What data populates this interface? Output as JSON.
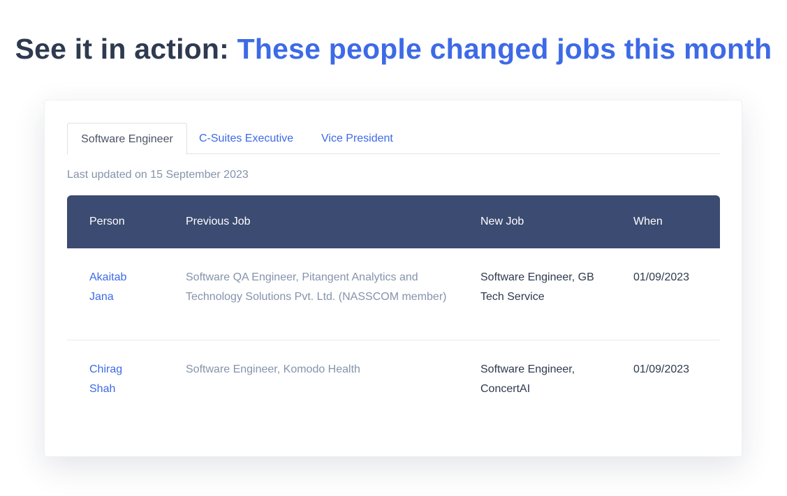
{
  "headline": {
    "lead": "See it in action: ",
    "accent": "These people changed jobs this month"
  },
  "tabs": [
    {
      "label": "Software Engineer",
      "active": true
    },
    {
      "label": "C-Suites Executive",
      "active": false
    },
    {
      "label": "Vice President",
      "active": false
    }
  ],
  "last_updated": "Last updated on 15 September 2023",
  "table": {
    "headers": [
      "Person",
      "Previous Job",
      "New Job",
      "When"
    ],
    "rows": [
      {
        "person": "Akaitab Jana",
        "previous_job": "Software QA Engineer, Pitangent Analytics and Technology Solutions Pvt. Ltd. (NASSCOM member)",
        "new_job": "Software Engineer, GB Tech Service",
        "when": "01/09/2023"
      },
      {
        "person": "Chirag Shah",
        "previous_job": "Software Engineer, Komodo Health",
        "new_job": "Software Engineer, ConcertAI",
        "when": "01/09/2023"
      }
    ]
  },
  "colors": {
    "accent": "#3d6ae6",
    "header_bg": "#3b4b71",
    "muted_text": "#8593ab",
    "dark_text": "#2e3a4f"
  }
}
